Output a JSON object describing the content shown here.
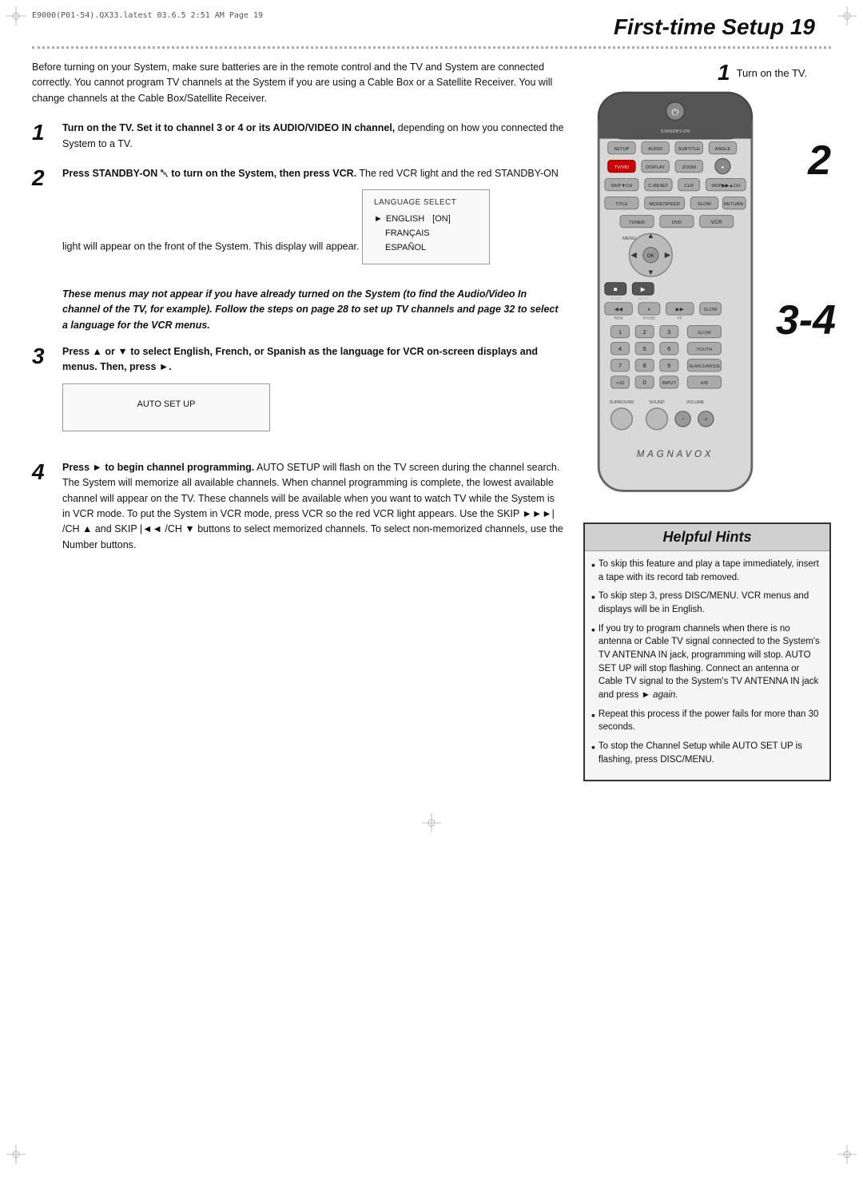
{
  "meta": {
    "doc_ref": "E9000(P01-54).QX33.latest   03.6.5  2:51 AM   Page 19"
  },
  "header": {
    "title": "First-time Setup  19"
  },
  "intro": {
    "text": "Before turning on your System, make sure batteries are in the remote control and the TV and System are connected correctly. You cannot program TV channels at the System if you are using a Cable Box or a Satellite Receiver. You will change channels at the Cable Box/Satellite Receiver."
  },
  "steps": [
    {
      "number": "1",
      "text_bold": "Turn on the TV. Set it to channel 3 or 4 or its AUDIO/VIDEO IN channel,",
      "text_normal": " depending on how you connected the System to a TV."
    },
    {
      "number": "2",
      "text_bold": "Press STANDBY-ON ␀ to turn on the System, then press VCR.",
      "text_normal": " The red VCR light and the red STANDBY-ON light will appear on the front of the System. This display will appear."
    },
    {
      "number": "3",
      "text_bold": "Press ▲ or ▼ to select English, French, or Spanish as the language for VCR on-screen displays and menus. Then, press ►."
    },
    {
      "number": "4",
      "text_bold": "Press ► to begin channel programming.",
      "text_normal": " AUTO SETUP will flash on the TV screen during the channel search. The System will memorize all available channels. When channel programming is complete, the lowest available channel will appear on the TV. These channels will be available when you want to watch TV while the System is in VCR mode. To put the System in VCR mode, press VCR so the red VCR light appears. Use the SKIP ►►►| /CH ▲ and SKIP |◄◄ /CH ▼ buttons to select memorized channels. To select non-memorized channels, use the Number buttons."
    }
  ],
  "italic_note": "These menus may not appear if you have already turned on the System (to find the Audio/Video In channel of the TV, for example). Follow the steps on page 28 to set up TV channels and page 32 to select a language for the VCR menus.",
  "language_box": {
    "title": "LANGUAGE SELECT",
    "items": [
      {
        "label": "ENGLISH",
        "tag": "[ON]",
        "active": true
      },
      {
        "label": "FRANÇAIS",
        "active": false
      },
      {
        "label": "ESPAÑOL",
        "active": false
      }
    ]
  },
  "autosetup_box": {
    "label": "AUTO SET UP"
  },
  "right_col": {
    "step1_label": "Turn on the TV.",
    "step2_label": "2",
    "step34_label": "3-4"
  },
  "helpful_hints": {
    "title": "Helpful Hints",
    "items": [
      "To skip this feature and play a tape immediately, insert a tape with its record tab removed.",
      "To skip step 3, press DISC/MENU. VCR menus and displays will be in English.",
      "If you try to program channels when there is no antenna or Cable TV signal connected to the System's TV ANTENNA IN jack, programming will stop. AUTO SET UP will stop flashing. Connect an antenna or Cable TV signal to the System's TV ANTENNA IN jack and press ► again.",
      "Repeat this process if the power fails for more than 30 seconds.",
      "To stop the Channel Setup while AUTO SET UP is flashing, press DISC/MENU."
    ]
  },
  "brand": "MAGNAVOX"
}
